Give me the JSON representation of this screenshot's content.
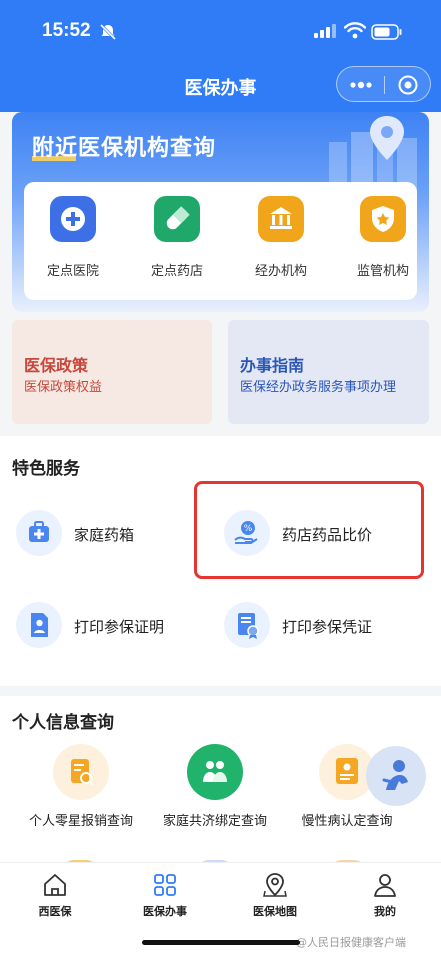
{
  "status_bar": {
    "time": "15:52"
  },
  "nav": {
    "title": "医保办事"
  },
  "nearby": {
    "title": "附近医保机构查询",
    "items": [
      {
        "label": "定点医院",
        "icon": "plus-icon",
        "color": "#3d6fe6"
      },
      {
        "label": "定点药店",
        "icon": "pill-icon",
        "color": "#1fa86a"
      },
      {
        "label": "经办机构",
        "icon": "bank-icon",
        "color": "#f0a51a"
      },
      {
        "label": "监管机构",
        "icon": "shield-star-icon",
        "color": "#f0a51a"
      }
    ]
  },
  "policy_card": {
    "title": "医保政策",
    "subtitle": "医保政策权益"
  },
  "guide_card": {
    "title": "办事指南",
    "subtitle": "医保经办政务服务事项办理"
  },
  "special": {
    "title": "特色服务",
    "items": [
      {
        "label": "家庭药箱",
        "icon": "medicine-box-icon"
      },
      {
        "label": "药店药品比价",
        "icon": "price-compare-icon"
      },
      {
        "label": "打印参保证明",
        "icon": "document-person-icon"
      },
      {
        "label": "打印参保凭证",
        "icon": "certificate-icon"
      }
    ]
  },
  "personal": {
    "title": "个人信息查询",
    "items": [
      {
        "label": "个人零星报销查询",
        "icon": "receipt-search-icon"
      },
      {
        "label": "家庭共济绑定查询",
        "icon": "family-icon"
      },
      {
        "label": "慢性病认定查询",
        "icon": "id-card-icon"
      }
    ]
  },
  "tabs": [
    {
      "label": "西医保",
      "icon": "home-icon"
    },
    {
      "label": "医保办事",
      "icon": "grid-icon",
      "active": true
    },
    {
      "label": "医保地图",
      "icon": "map-pin-icon"
    },
    {
      "label": "我的",
      "icon": "user-icon"
    }
  ],
  "watermark": "@人民日报健康客户端"
}
